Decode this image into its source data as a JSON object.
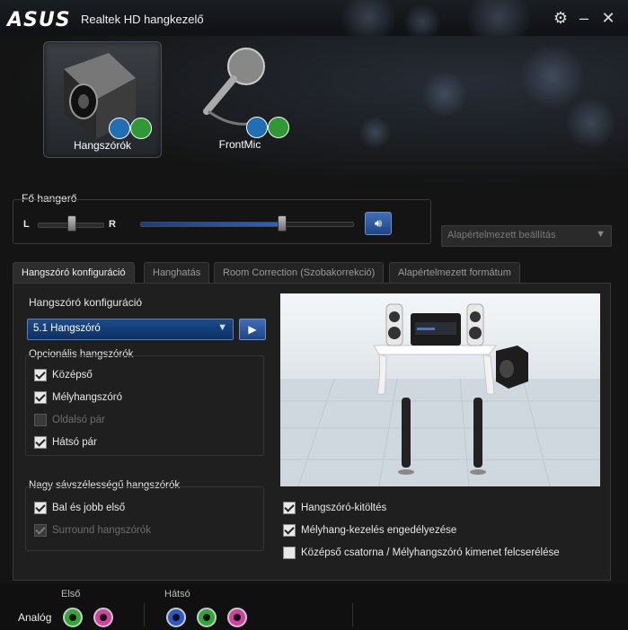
{
  "window": {
    "brand": "ASUS",
    "title": "Realtek HD hangkezelő"
  },
  "devices": [
    {
      "label": "Hangszórók",
      "selected": true
    },
    {
      "label": "FrontMic",
      "selected": false
    }
  ],
  "main_volume": {
    "label": "Fő hangerő",
    "left": "L",
    "right": "R",
    "balance": 0.5,
    "level": 0.6
  },
  "default_setting": {
    "label": "Alapértelmezett beállítás"
  },
  "tabs": [
    {
      "label": "Hangszóró konfiguráció",
      "active": true
    },
    {
      "label": "Hanghatás",
      "active": false
    },
    {
      "label": "Room Correction (Szobakorrekció)",
      "active": false
    },
    {
      "label": "Alapértelmezett formátum",
      "active": false
    }
  ],
  "speaker_config": {
    "label": "Hangszóró konfiguráció",
    "selected": "5.1 Hangszóró"
  },
  "optional_speakers": {
    "label": "Opcionális hangszórók",
    "items": [
      {
        "label": "Középső",
        "checked": true,
        "enabled": true
      },
      {
        "label": "Mélyhangszóró",
        "checked": true,
        "enabled": true
      },
      {
        "label": "Oldalsó pár",
        "checked": false,
        "enabled": false
      },
      {
        "label": "Hátsó pár",
        "checked": true,
        "enabled": true
      }
    ]
  },
  "fullrange": {
    "label": "Nagy sávszélességű hangszórók",
    "items": [
      {
        "label": "Bal és jobb első",
        "checked": true,
        "enabled": true
      },
      {
        "label": "Surround hangszórók",
        "checked": true,
        "enabled": false
      }
    ]
  },
  "options": [
    {
      "label": "Hangszóró-kitöltés",
      "checked": true
    },
    {
      "label": "Mélyhang-kezelés engedélyezése",
      "checked": true
    },
    {
      "label": "Középső csatorna / Mélyhangszóró kimenet felcserélése",
      "checked": false
    }
  ],
  "jacks": {
    "analog_label": "Analóg",
    "front_label": "Első",
    "rear_label": "Hátsó",
    "front_colors": [
      "#2eaa2e",
      "#d43fa0"
    ],
    "rear_colors": [
      "#2b59c8",
      "#2eaa2e",
      "#d43fa0"
    ]
  },
  "colors": {
    "accent": "#1c4c8c",
    "ok": "#2f9a33"
  }
}
